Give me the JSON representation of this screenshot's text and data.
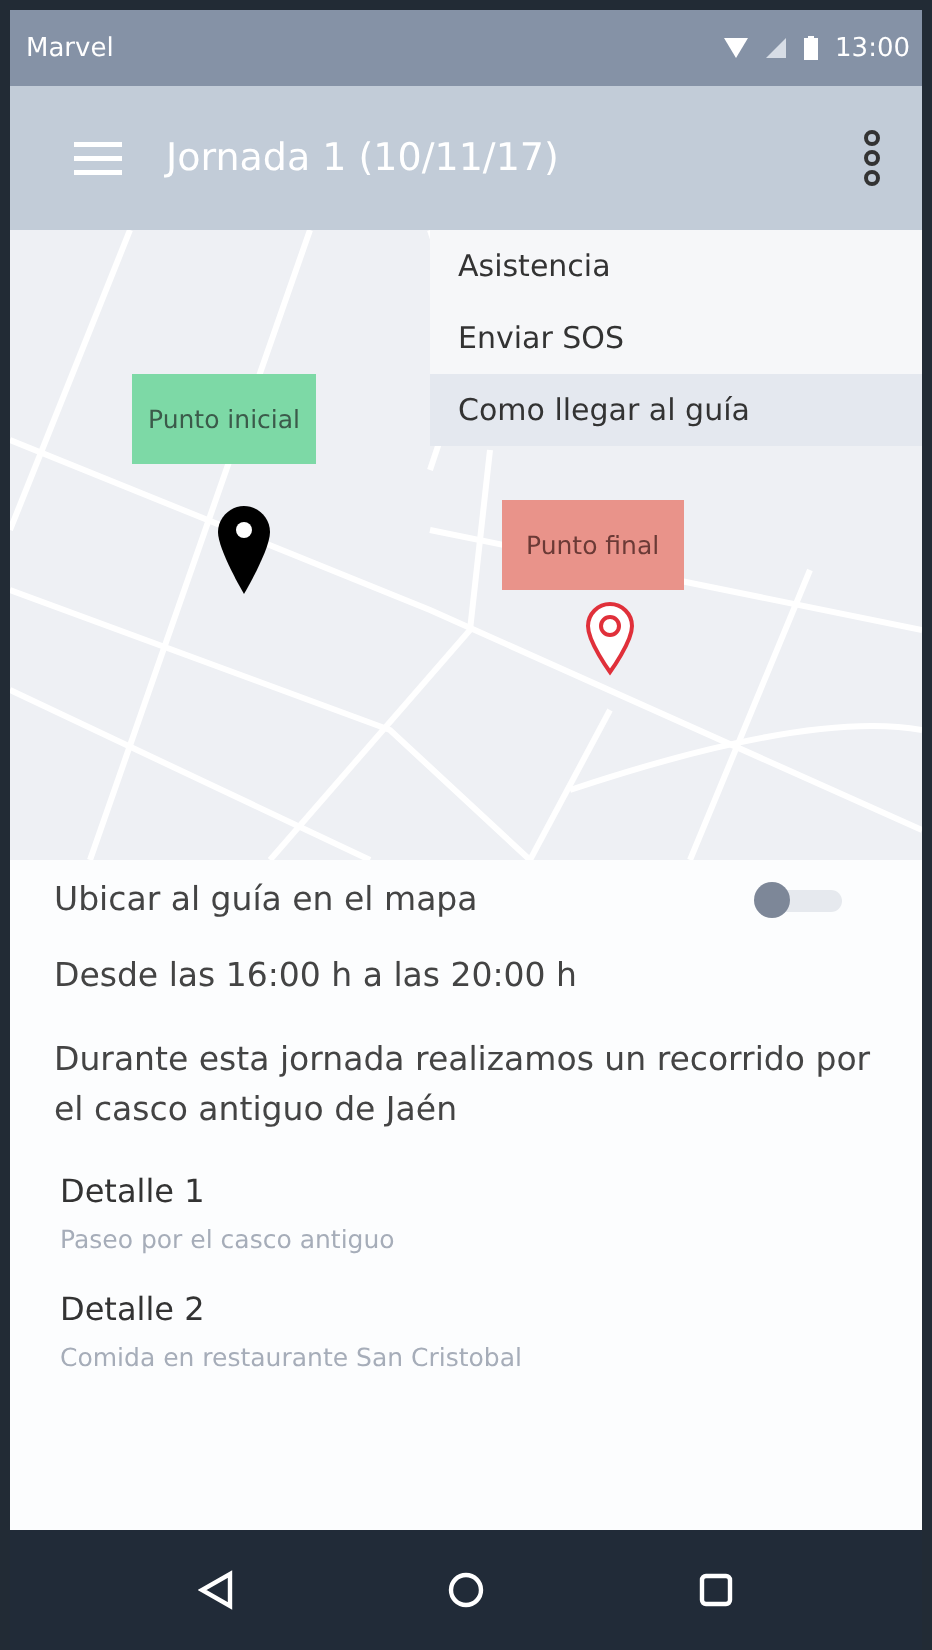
{
  "status_bar": {
    "carrier": "Marvel",
    "time": "13:00"
  },
  "app_bar": {
    "title": "Jornada 1 (10/11/17)"
  },
  "map": {
    "kind": "picture",
    "markers": [
      {
        "label": "Punto inicial",
        "kind": "start",
        "color": "#7dd9a6"
      },
      {
        "label": "Punto final",
        "kind": "end",
        "color": "#e9938a"
      }
    ]
  },
  "menu": {
    "items": [
      {
        "label": "Asistencia",
        "selected": false
      },
      {
        "label": "Enviar SOS",
        "selected": false
      },
      {
        "label": "Como llegar al guía",
        "selected": true
      }
    ]
  },
  "toggle": {
    "label": "Ubicar al guía en el mapa",
    "on": false
  },
  "schedule": "Desde las 16:00 h a las 20:00 h",
  "description": "Durante esta jornada realizamos un recorrido por el casco antiguo de Jaén",
  "details": [
    {
      "title": "Detalle 1",
      "subtitle": "Paseo por el casco antiguo"
    },
    {
      "title": "Detalle 2",
      "subtitle": "Comida en restaurante San Cristobal"
    }
  ]
}
